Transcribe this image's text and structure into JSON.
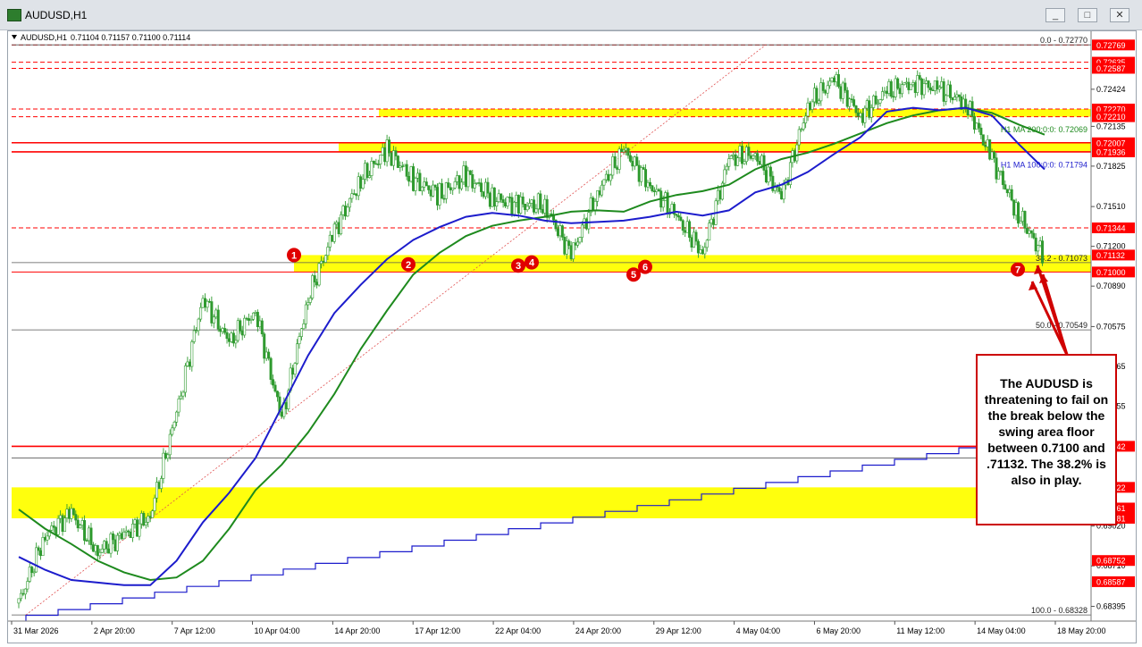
{
  "window": {
    "title": "AUDUSD,H1",
    "buttons": [
      "_",
      "□",
      "✕"
    ]
  },
  "chart_header": {
    "symbol": "AUDUSD,H1",
    "ohlc": "0.71104 0.71157 0.71100 0.71114"
  },
  "callout": {
    "text": "The AUDUSD is threatening to fail on the break below the swing area floor between 0.7100 and .71132.  The 38.2% is also in play."
  },
  "colors": {
    "candle": "#2f9a2f",
    "ma100": "#1c1ccc",
    "ma200": "#1e8a1e",
    "zone": "#ffff00",
    "level_line": "#ff0000",
    "marker": "#e00000",
    "fib_line": "#555555"
  },
  "chart_data": {
    "type": "candlestick",
    "title": "AUDUSD,H1",
    "y_range": [
      0.6828,
      0.7282
    ],
    "x_labels": [
      "31 Mar 2026",
      "2 Apr 20:00",
      "7 Apr 12:00",
      "10 Apr 04:00",
      "14 Apr 20:00",
      "17 Apr 12:00",
      "22 Apr 04:00",
      "24 Apr 20:00",
      "29 Apr 12:00",
      "4 May 04:00",
      "6 May 20:00",
      "11 May 12:00",
      "14 May 04:00",
      "18 May 20:00"
    ],
    "y_tick_labels": [
      "0.72424",
      "0.72135",
      "0.71825",
      "0.71510",
      "0.71200",
      "0.70890",
      "0.70575",
      "0.70265",
      "0.69955",
      "0.69640",
      "0.69330",
      "0.69020",
      "0.68710",
      "0.68395"
    ],
    "price_tags": [
      {
        "label": "0.72769",
        "value": 0.72769,
        "color": "#ff0000"
      },
      {
        "label": "0.72635",
        "value": 0.72635,
        "color": "#ff0000"
      },
      {
        "label": "0.72587",
        "value": 0.72587,
        "color": "#ff0000"
      },
      {
        "label": "0.72270",
        "value": 0.7227,
        "color": "#ff0000"
      },
      {
        "label": "0.72210",
        "value": 0.7221,
        "color": "#ff0000"
      },
      {
        "label": "0.72007",
        "value": 0.72007,
        "color": "#ff0000"
      },
      {
        "label": "0.71936",
        "value": 0.71936,
        "color": "#ff0000"
      },
      {
        "label": "0.71344",
        "value": 0.71344,
        "color": "#ff0000"
      },
      {
        "label": "0.71132",
        "value": 0.71132,
        "color": "#ff0000"
      },
      {
        "label": "0.71000",
        "value": 0.71,
        "color": "#ff0000"
      },
      {
        "label": "0.69642",
        "value": 0.69642,
        "color": "#ff0000"
      },
      {
        "label": "0.69322",
        "value": 0.69322,
        "color": "#ff0000"
      },
      {
        "label": "0.69161",
        "value": 0.69161,
        "color": "#ff0000"
      },
      {
        "label": "0.69081",
        "value": 0.69081,
        "color": "#ff0000"
      },
      {
        "label": "0.68752",
        "value": 0.68752,
        "color": "#ff0000"
      },
      {
        "label": "0.68587",
        "value": 0.68587,
        "color": "#ff0000"
      }
    ],
    "fib_levels": [
      {
        "label": "0.0 - 0.72770",
        "value": 0.7277
      },
      {
        "label": "38.2 - 0.71073",
        "value": 0.71073
      },
      {
        "label": "50.0 - 0.70549",
        "value": 0.70549
      },
      {
        "label": "100.0 - 0.68328",
        "value": 0.68328
      }
    ],
    "ma_labels": [
      {
        "label": "H1 MA 200:0:0: 0.72069",
        "value": 0.72069
      },
      {
        "label": "H1 MA 100:0:0: 0.71794",
        "value": 0.71794
      }
    ],
    "zones": [
      {
        "from": 0.7221,
        "to": 0.7227
      },
      {
        "from": 0.71936,
        "to": 0.72007
      },
      {
        "from": 0.71,
        "to": 0.71132
      },
      {
        "from": 0.69081,
        "to": 0.69322
      }
    ],
    "red_lines": [
      0.72769,
      0.72635,
      0.72587,
      0.7227,
      0.7221,
      0.72007,
      0.71936,
      0.71344,
      0.71,
      0.69642
    ],
    "markers": [
      "1",
      "2",
      "3",
      "4",
      "5",
      "6",
      "7"
    ],
    "series": [
      {
        "name": "H1 MA 100",
        "values": [
          0.6878,
          0.6868,
          0.686,
          0.6858,
          0.6856,
          0.6856,
          0.6875,
          0.6905,
          0.6928,
          0.6955,
          0.6995,
          0.7035,
          0.7068,
          0.709,
          0.711,
          0.7125,
          0.7135,
          0.7143,
          0.7146,
          0.7144,
          0.714,
          0.7138,
          0.7139,
          0.714,
          0.7143,
          0.7147,
          0.7144,
          0.7148,
          0.7162,
          0.7168,
          0.7178,
          0.7192,
          0.7205,
          0.7225,
          0.7228,
          0.7226,
          0.7228,
          0.7222,
          0.72,
          0.718
        ]
      },
      {
        "name": "H1 MA 200",
        "values": [
          0.6915,
          0.69,
          0.6888,
          0.6875,
          0.6866,
          0.686,
          0.6862,
          0.6875,
          0.69,
          0.693,
          0.695,
          0.6975,
          0.7005,
          0.704,
          0.707,
          0.7098,
          0.7115,
          0.7128,
          0.7136,
          0.714,
          0.7143,
          0.7147,
          0.7148,
          0.7147,
          0.7155,
          0.716,
          0.7163,
          0.7168,
          0.718,
          0.7188,
          0.7193,
          0.72,
          0.7208,
          0.7216,
          0.7222,
          0.7226,
          0.7228,
          0.7224,
          0.7215,
          0.7207
        ]
      },
      {
        "name": "Close",
        "values": [
          0.6842,
          0.6895,
          0.6912,
          0.6882,
          0.6895,
          0.691,
          0.699,
          0.708,
          0.7045,
          0.707,
          0.6985,
          0.708,
          0.7132,
          0.7172,
          0.7195,
          0.7172,
          0.716,
          0.7175,
          0.7158,
          0.7152,
          0.7152,
          0.7113,
          0.7162,
          0.7195,
          0.7168,
          0.7143,
          0.7115,
          0.7188,
          0.7192,
          0.7158,
          0.723,
          0.725,
          0.7222,
          0.724,
          0.7248,
          0.7242,
          0.7232,
          0.7188,
          0.7145,
          0.7111
        ]
      }
    ]
  }
}
